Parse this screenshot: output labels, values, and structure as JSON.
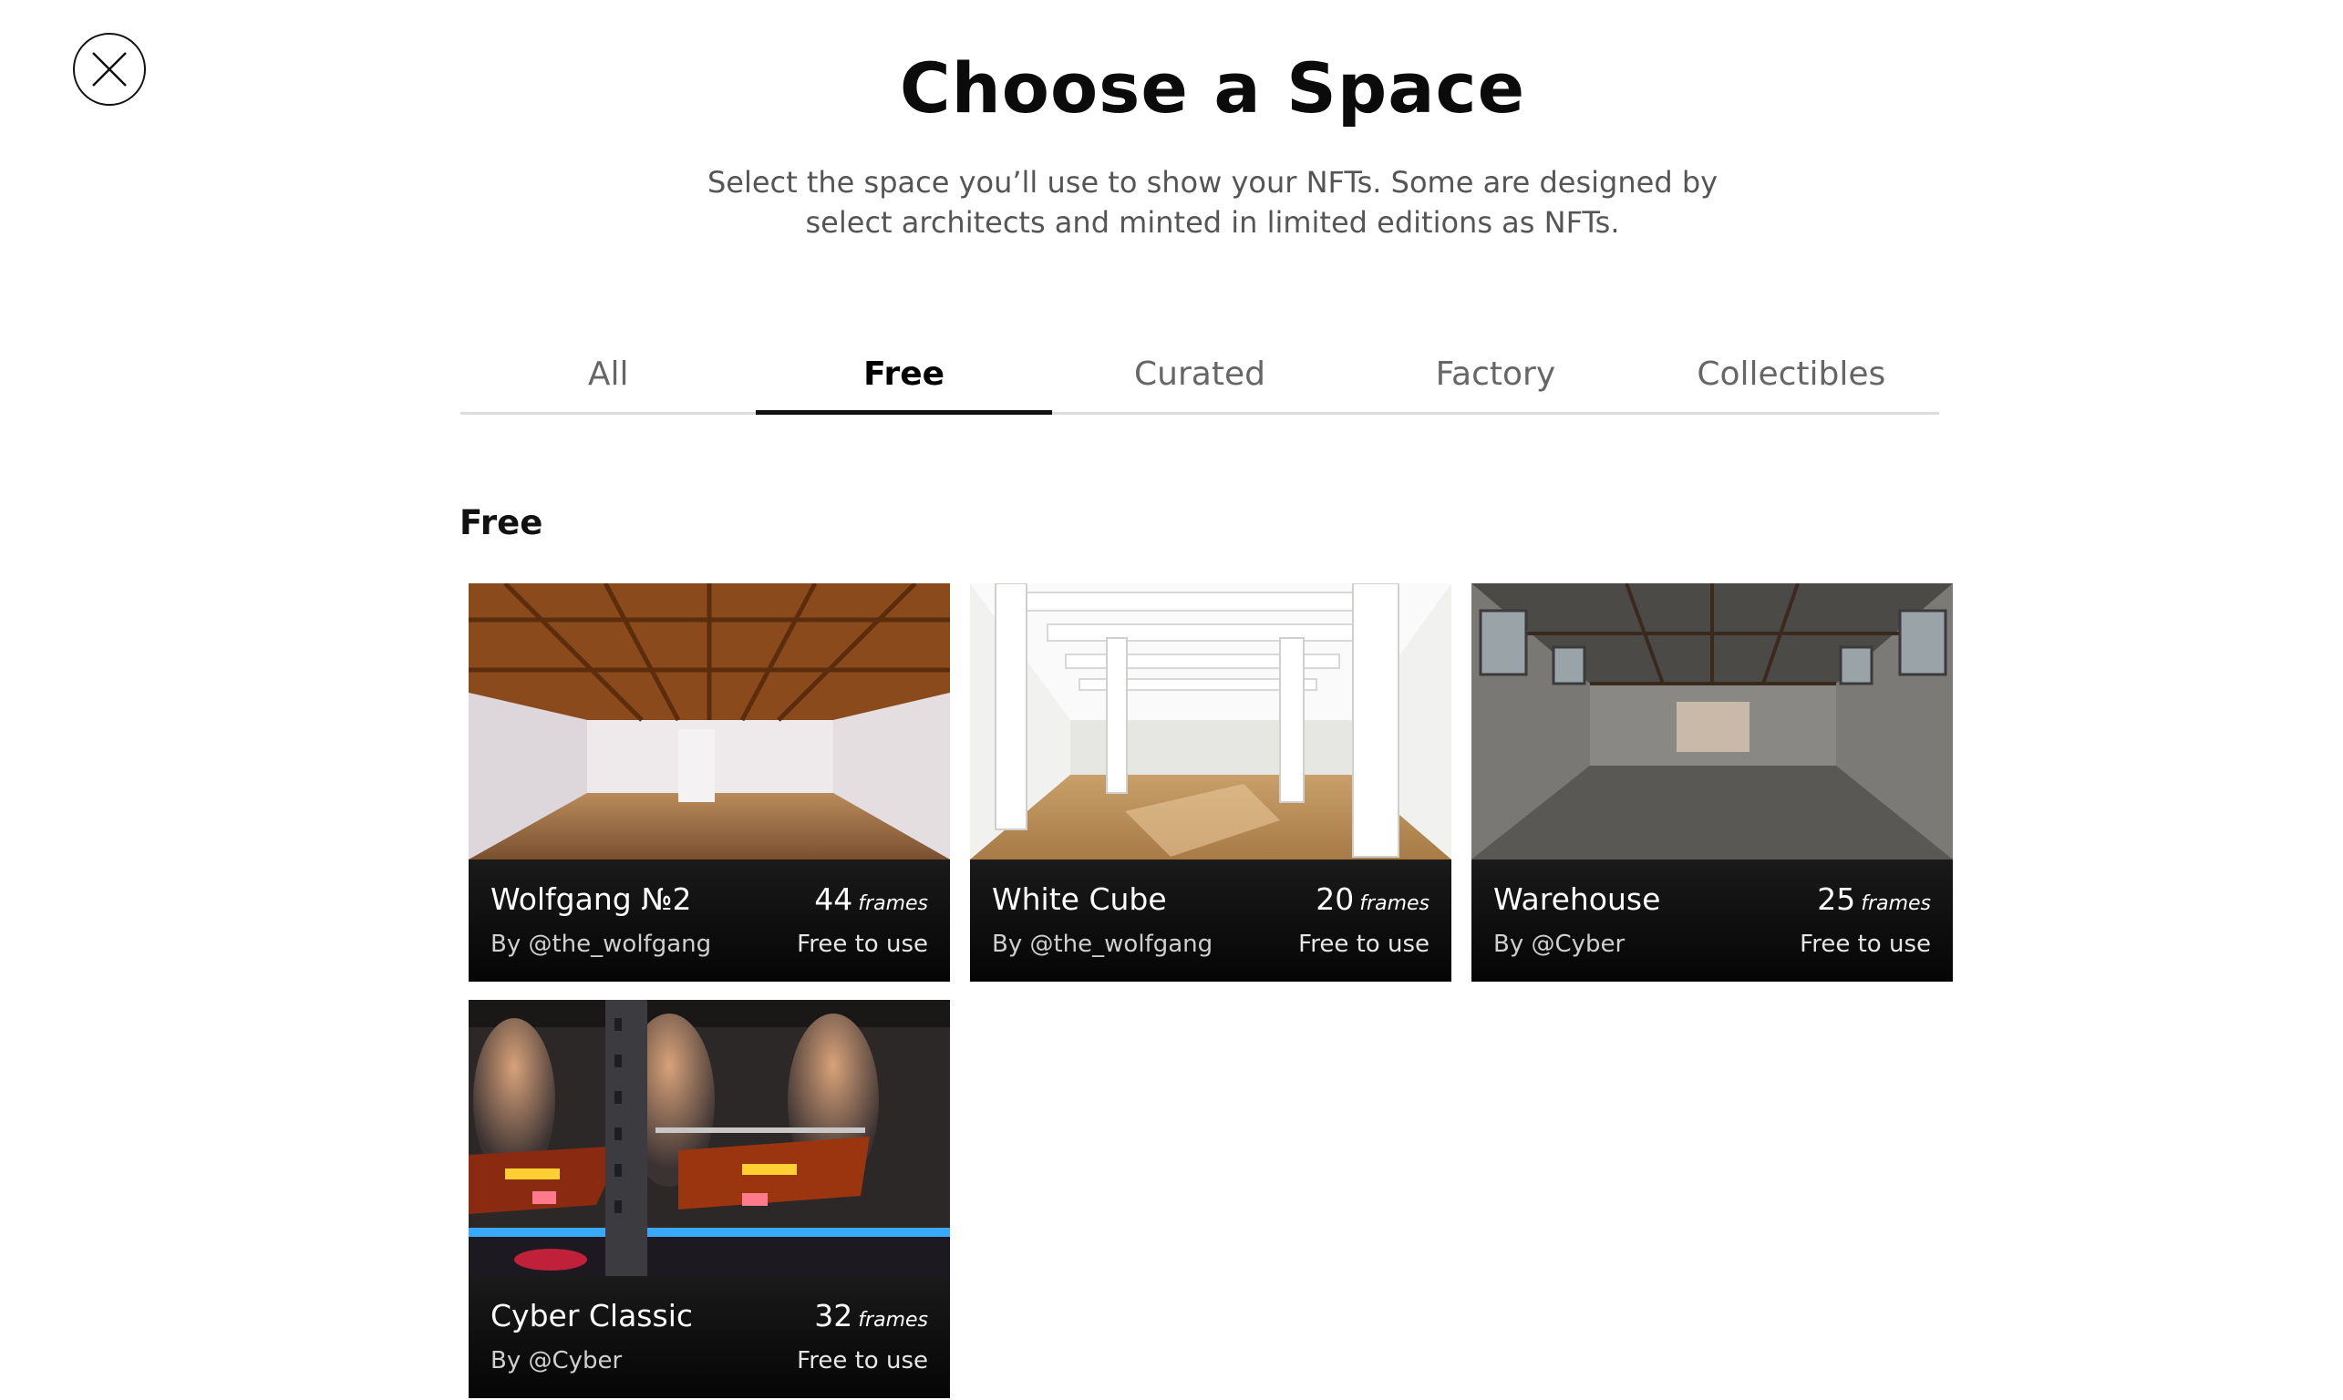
{
  "header": {
    "close_label": "Close",
    "title": "Choose a Space",
    "subtitle": "Select the space you’ll use to show your NFTs. Some are designed by select architects and minted in limited editions as NFTs."
  },
  "tabs": [
    {
      "label": "All",
      "active": false
    },
    {
      "label": "Free",
      "active": true
    },
    {
      "label": "Curated",
      "active": false
    },
    {
      "label": "Factory",
      "active": false
    },
    {
      "label": "Collectibles",
      "active": false
    }
  ],
  "section": {
    "title": "Free"
  },
  "cards": [
    {
      "name": "Wolfgang №2",
      "frames": "44",
      "frames_unit": "frames",
      "author": "By @the_wolfgang",
      "price": "Free to use"
    },
    {
      "name": "White Cube",
      "frames": "20",
      "frames_unit": "frames",
      "author": "By @the_wolfgang",
      "price": "Free to use"
    },
    {
      "name": "Warehouse",
      "frames": "25",
      "frames_unit": "frames",
      "author": "By @Cyber",
      "price": "Free to use"
    },
    {
      "name": "Cyber Classic",
      "frames": "32",
      "frames_unit": "frames",
      "author": "By @Cyber",
      "price": "Free to use"
    }
  ]
}
